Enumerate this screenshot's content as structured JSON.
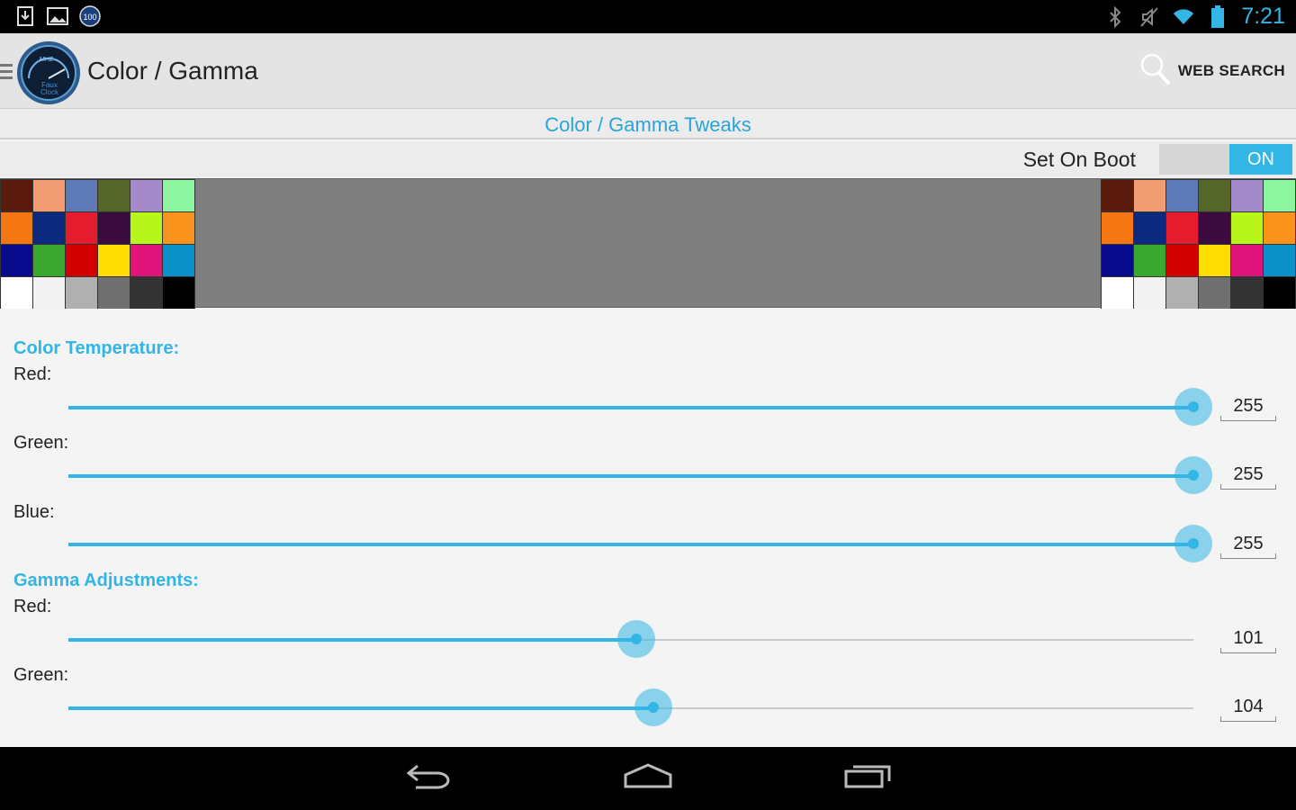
{
  "status_bar": {
    "time": "7:21",
    "battery_badge": "100",
    "icons": [
      "download-icon",
      "image-icon",
      "battery-saver-icon",
      "bluetooth-icon",
      "mute-icon",
      "wifi-icon",
      "battery-icon"
    ]
  },
  "action_bar": {
    "title": "Color / Gamma",
    "web_search_label": "WEB SEARCH",
    "logo_text_top": "MHZ",
    "logo_text": "Faux Clock"
  },
  "section": {
    "title": "Color / Gamma Tweaks"
  },
  "set_on_boot": {
    "label": "Set On Boot",
    "state": "ON"
  },
  "swatches": {
    "colors": [
      "#5a1a0c",
      "#f29c74",
      "#5d79b6",
      "#556628",
      "#a48acb",
      "#8cf5a0",
      "#f57713",
      "#0c2980",
      "#e41c2d",
      "#3b0a3f",
      "#b8f51a",
      "#f9931b",
      "#0a0a8c",
      "#3aa830",
      "#d40000",
      "#ffdd00",
      "#e0157b",
      "#0a92c8",
      "#ffffff",
      "#f2f2f2",
      "#b0b0b0",
      "#707070",
      "#333333",
      "#000000"
    ]
  },
  "color_temperature": {
    "title": "Color Temperature:",
    "sliders": [
      {
        "label": "Red:",
        "value": "255",
        "fraction": 1.0
      },
      {
        "label": "Green:",
        "value": "255",
        "fraction": 1.0
      },
      {
        "label": "Blue:",
        "value": "255",
        "fraction": 1.0
      }
    ]
  },
  "gamma": {
    "title": "Gamma Adjustments:",
    "sliders": [
      {
        "label": "Red:",
        "value": "101",
        "fraction": 0.505
      },
      {
        "label": "Green:",
        "value": "104",
        "fraction": 0.52
      }
    ]
  },
  "colors": {
    "accent": "#33b5e5"
  }
}
